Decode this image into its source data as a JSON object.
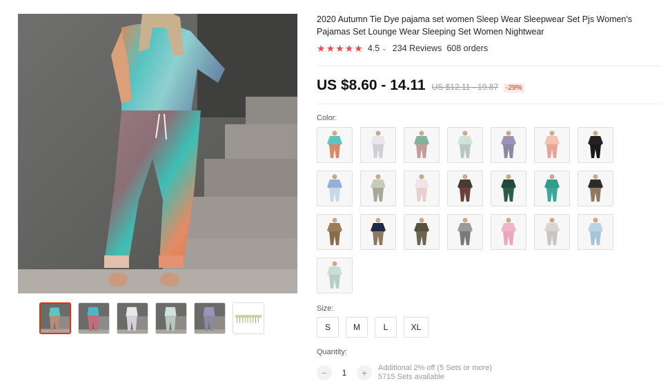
{
  "product": {
    "title": "2020 Autumn Tie Dye pajama set women Sleep Wear Sleepwear Set Pjs Women's Pajamas Set Lounge Wear Sleeping Set Women Nightwear"
  },
  "rating": {
    "stars": 5,
    "value": "4.5",
    "reviews": "234 Reviews",
    "orders": "608 orders"
  },
  "price": {
    "current": "US $8.60 - 14.11",
    "original": "US $12.11 - 19.87",
    "discount": "-29%"
  },
  "color": {
    "label": "Color:",
    "swatches": [
      {
        "name": "tie-dye-teal",
        "top": "#5ec4c0",
        "bottom": "#d98a6a"
      },
      {
        "name": "white-grey",
        "top": "#e8e8ec",
        "bottom": "#cfcfd6"
      },
      {
        "name": "green-pink",
        "top": "#7fb39b",
        "bottom": "#c99a9a"
      },
      {
        "name": "mint-grey",
        "top": "#cfe3dc",
        "bottom": "#b9c7c3"
      },
      {
        "name": "purple-grey",
        "top": "#9b93b8",
        "bottom": "#8a8aa0"
      },
      {
        "name": "peach-pink",
        "top": "#f2c1b0",
        "bottom": "#e7a497"
      },
      {
        "name": "black",
        "top": "#222222",
        "bottom": "#1a1a1a"
      },
      {
        "name": "blue-white",
        "top": "#8fb2d6",
        "bottom": "#c9d7e6"
      },
      {
        "name": "sage-grey",
        "top": "#c7cbb8",
        "bottom": "#a6a99a"
      },
      {
        "name": "floral-white",
        "top": "#f1e4e6",
        "bottom": "#e6cfd2"
      },
      {
        "name": "floral-dark",
        "top": "#4a3a33",
        "bottom": "#6b3f3a"
      },
      {
        "name": "dark-green-floral",
        "top": "#1e4b3c",
        "bottom": "#2a5d4a"
      },
      {
        "name": "teal-print",
        "top": "#2e9d8c",
        "bottom": "#3aa79a"
      },
      {
        "name": "black-khaki",
        "top": "#2b2b2b",
        "bottom": "#8e7a62"
      },
      {
        "name": "khaki",
        "top": "#9c7b58",
        "bottom": "#8a6b4c"
      },
      {
        "name": "navy-khaki",
        "top": "#1f2a4a",
        "bottom": "#8b7a60"
      },
      {
        "name": "olive-camo",
        "top": "#55523e",
        "bottom": "#6a654c"
      },
      {
        "name": "grey-camo",
        "top": "#9a9a9a",
        "bottom": "#7a7a7a"
      },
      {
        "name": "pink-white",
        "top": "#f0b6c8",
        "bottom": "#e8a8bd"
      },
      {
        "name": "light-grey-pattern",
        "top": "#d9d4cf",
        "bottom": "#c9c4bd"
      },
      {
        "name": "light-blue",
        "top": "#bcd3e6",
        "bottom": "#a9c3d9"
      },
      {
        "name": "pale-green",
        "top": "#c9dfd6",
        "bottom": "#b7cfc7"
      }
    ]
  },
  "size": {
    "label": "Size:",
    "options": [
      "S",
      "M",
      "L",
      "XL"
    ]
  },
  "quantity": {
    "label": "Quantity:",
    "minus": "−",
    "plus": "+",
    "value": "1",
    "offer": "Additional 2% off (5 Sets or more)",
    "stock": "5715 Sets available"
  },
  "gallery": {
    "thumbnails": [
      {
        "name": "thumb-1",
        "top": "#5ec4c0",
        "bottom": "#b88a7a",
        "active": true
      },
      {
        "name": "thumb-2",
        "top": "#4fb6c6",
        "bottom": "#c56b7b",
        "active": false
      },
      {
        "name": "thumb-3",
        "top": "#e7e7ea",
        "bottom": "#d2d2d8",
        "active": false
      },
      {
        "name": "thumb-4",
        "top": "#cfe3dc",
        "bottom": "#b9c7c3",
        "active": false
      },
      {
        "name": "thumb-5",
        "top": "#9b93b8",
        "bottom": "#8a8aa0",
        "active": false
      },
      {
        "name": "thumb-6-size-chart",
        "top": "#c7d39a",
        "bottom": "#9aa86a",
        "active": false
      }
    ]
  },
  "colors": {
    "accent": "#e62e04",
    "star": "#f04a45"
  }
}
